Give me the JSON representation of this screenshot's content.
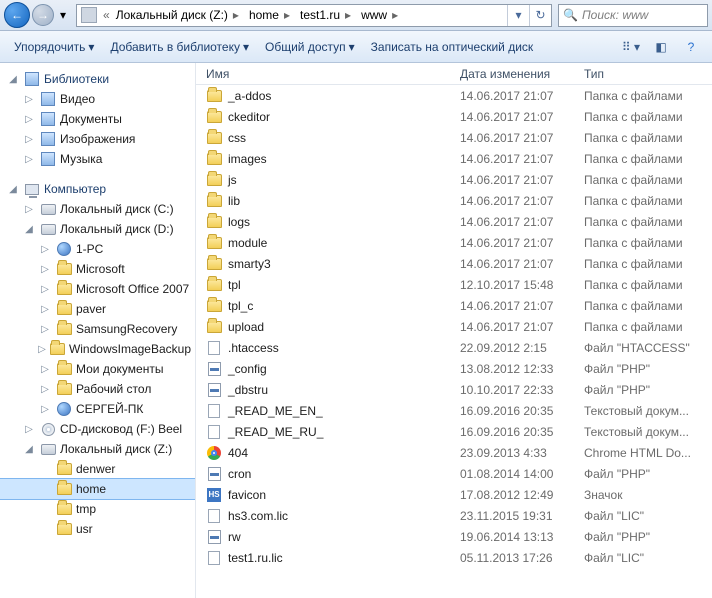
{
  "address": {
    "crumbs": [
      "Локальный диск (Z:)",
      "home",
      "test1.ru",
      "www"
    ]
  },
  "search": {
    "placeholder": "Поиск: www"
  },
  "commands": {
    "organize": "Упорядочить",
    "addlib": "Добавить в библиотеку",
    "share": "Общий доступ",
    "burn": "Записать на оптический диск"
  },
  "nav": {
    "libraries": {
      "label": "Библиотеки",
      "items": [
        {
          "label": "Видео",
          "icon": "lib"
        },
        {
          "label": "Документы",
          "icon": "lib"
        },
        {
          "label": "Изображения",
          "icon": "lib"
        },
        {
          "label": "Музыка",
          "icon": "lib"
        }
      ]
    },
    "computer": {
      "label": "Компьютер",
      "items": [
        {
          "label": "Локальный диск (C:)",
          "icon": "drive",
          "indent": 1,
          "tw": "▷"
        },
        {
          "label": "Локальный диск (D:)",
          "icon": "drive",
          "indent": 1,
          "tw": "◢"
        },
        {
          "label": "1-PC",
          "icon": "net",
          "indent": 2,
          "tw": "▷"
        },
        {
          "label": "Microsoft",
          "icon": "folder",
          "indent": 2,
          "tw": "▷"
        },
        {
          "label": "Microsoft Office 2007",
          "icon": "folder",
          "indent": 2,
          "tw": "▷"
        },
        {
          "label": "paver",
          "icon": "folder",
          "indent": 2,
          "tw": "▷"
        },
        {
          "label": "SamsungRecovery",
          "icon": "folder",
          "indent": 2,
          "tw": "▷"
        },
        {
          "label": "WindowsImageBackup",
          "icon": "folder",
          "indent": 2,
          "tw": "▷"
        },
        {
          "label": "Мои документы",
          "icon": "folder",
          "indent": 2,
          "tw": "▷"
        },
        {
          "label": "Рабочий стол",
          "icon": "folder",
          "indent": 2,
          "tw": "▷"
        },
        {
          "label": "СЕРГЕЙ-ПК",
          "icon": "net",
          "indent": 2,
          "tw": "▷"
        },
        {
          "label": "CD-дисковод (F:) Beel",
          "icon": "cd",
          "indent": 1,
          "tw": "▷"
        },
        {
          "label": "Локальный диск (Z:)",
          "icon": "drive",
          "indent": 1,
          "tw": "◢"
        },
        {
          "label": "denwer",
          "icon": "folder",
          "indent": 2,
          "tw": ""
        },
        {
          "label": "home",
          "icon": "folder",
          "indent": 2,
          "tw": "",
          "sel": true
        },
        {
          "label": "tmp",
          "icon": "folder",
          "indent": 2,
          "tw": ""
        },
        {
          "label": "usr",
          "icon": "folder",
          "indent": 2,
          "tw": ""
        }
      ]
    }
  },
  "columns": {
    "name": "Имя",
    "date": "Дата изменения",
    "type": "Тип"
  },
  "files": [
    {
      "icon": "folder",
      "name": "_a-ddos",
      "date": "14.06.2017 21:07",
      "type": "Папка с файлами"
    },
    {
      "icon": "folder",
      "name": "ckeditor",
      "date": "14.06.2017 21:07",
      "type": "Папка с файлами"
    },
    {
      "icon": "folder",
      "name": "css",
      "date": "14.06.2017 21:07",
      "type": "Папка с файлами"
    },
    {
      "icon": "folder",
      "name": "images",
      "date": "14.06.2017 21:07",
      "type": "Папка с файлами"
    },
    {
      "icon": "folder",
      "name": "js",
      "date": "14.06.2017 21:07",
      "type": "Папка с файлами"
    },
    {
      "icon": "folder",
      "name": "lib",
      "date": "14.06.2017 21:07",
      "type": "Папка с файлами"
    },
    {
      "icon": "folder",
      "name": "logs",
      "date": "14.06.2017 21:07",
      "type": "Папка с файлами"
    },
    {
      "icon": "folder",
      "name": "module",
      "date": "14.06.2017 21:07",
      "type": "Папка с файлами"
    },
    {
      "icon": "folder",
      "name": "smarty3",
      "date": "14.06.2017 21:07",
      "type": "Папка с файлами"
    },
    {
      "icon": "folder",
      "name": "tpl",
      "date": "12.10.2017 15:48",
      "type": "Папка с файлами"
    },
    {
      "icon": "folder",
      "name": "tpl_c",
      "date": "14.06.2017 21:07",
      "type": "Папка с файлами"
    },
    {
      "icon": "folder",
      "name": "upload",
      "date": "14.06.2017 21:07",
      "type": "Папка с файлами"
    },
    {
      "icon": "file",
      "name": ".htaccess",
      "date": "22.09.2012 2:15",
      "type": "Файл \"HTACCESS\""
    },
    {
      "icon": "php",
      "name": "_config",
      "date": "13.08.2012 12:33",
      "type": "Файл \"PHP\""
    },
    {
      "icon": "php",
      "name": "_dbstru",
      "date": "10.10.2017 22:33",
      "type": "Файл \"PHP\""
    },
    {
      "icon": "file",
      "name": "_READ_ME_EN_",
      "date": "16.09.2016 20:35",
      "type": "Текстовый докум..."
    },
    {
      "icon": "file",
      "name": "_READ_ME_RU_",
      "date": "16.09.2016 20:35",
      "type": "Текстовый докум..."
    },
    {
      "icon": "chrome",
      "name": "404",
      "date": "23.09.2013 4:33",
      "type": "Chrome HTML Do..."
    },
    {
      "icon": "php",
      "name": "cron",
      "date": "01.08.2014 14:00",
      "type": "Файл \"PHP\""
    },
    {
      "icon": "hs",
      "name": "favicon",
      "date": "17.08.2012 12:49",
      "type": "Значок"
    },
    {
      "icon": "file",
      "name": "hs3.com.lic",
      "date": "23.11.2015 19:31",
      "type": "Файл \"LIC\""
    },
    {
      "icon": "php",
      "name": "rw",
      "date": "19.06.2014 13:13",
      "type": "Файл \"PHP\""
    },
    {
      "icon": "file",
      "name": "test1.ru.lic",
      "date": "05.11.2013 17:26",
      "type": "Файл \"LIC\""
    }
  ]
}
